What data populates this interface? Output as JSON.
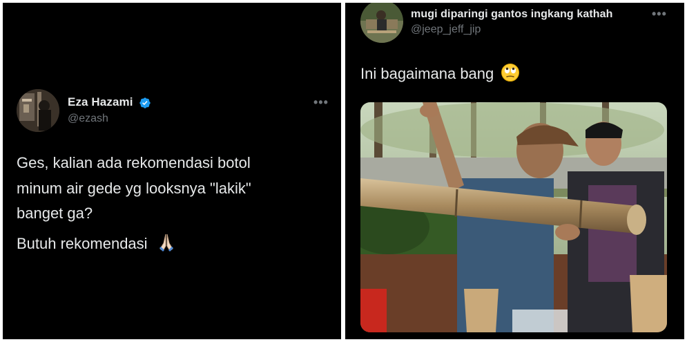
{
  "left_tweet": {
    "author": {
      "name": "Eza Hazami",
      "handle": "@ezash",
      "verified": true
    },
    "more_icon": "more-icon",
    "text_lines": [
      "Ges, kalian ada rekomendasi botol",
      "minum air gede yg looksnya \"lakik\"",
      "banget ga?"
    ],
    "text_second_paragraph": "Butuh rekomendasi",
    "emoji": "folded-hands"
  },
  "right_tweet": {
    "author": {
      "name": "mugi diparingi gantos ingkang kathah",
      "handle": "@jeep_jeff_jip"
    },
    "more_icon": "more-icon",
    "text": "Ini bagaimana bang",
    "emoji": "eye-roll-face",
    "media": "photo-bamboo-water-bottle"
  },
  "colors": {
    "background": "#000000",
    "text": "#e7e9ea",
    "secondary": "#71767b",
    "verified": "#1d9bf0"
  }
}
